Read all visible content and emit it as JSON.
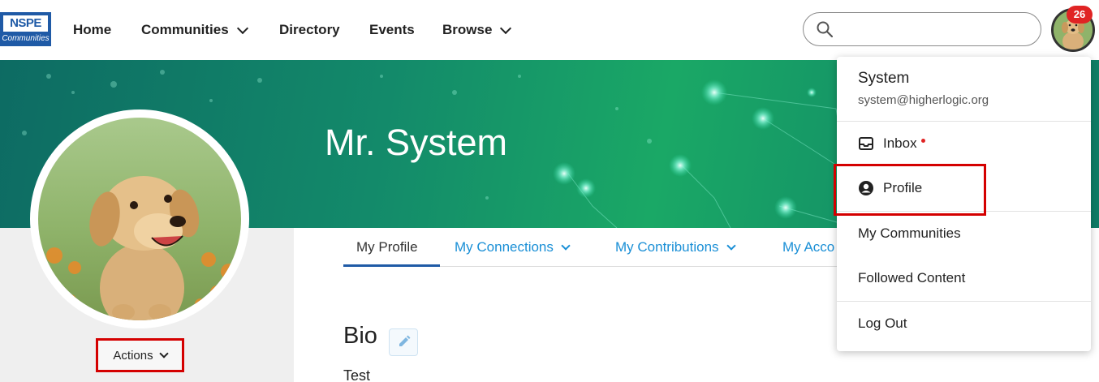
{
  "logo": {
    "top_text": "NSPE",
    "bottom_text": "Communities"
  },
  "nav": {
    "home": "Home",
    "communities": "Communities",
    "directory": "Directory",
    "events": "Events",
    "browse": "Browse"
  },
  "search": {
    "placeholder": ""
  },
  "notifications": {
    "count": "26"
  },
  "banner": {
    "name": "Mr. System"
  },
  "actions": {
    "label": "Actions"
  },
  "tabs": {
    "my_profile": "My Profile",
    "my_connections": "My Connections",
    "my_contributions": "My Contributions",
    "my_account": "My Acco"
  },
  "bio": {
    "heading": "Bio",
    "text": "Test"
  },
  "dropdown": {
    "name": "System",
    "email": "system@higherlogic.org",
    "inbox": "Inbox",
    "profile": "Profile",
    "my_communities": "My Communities",
    "followed_content": "Followed Content",
    "log_out": "Log Out"
  },
  "colors": {
    "accent_blue": "#1a8fd6",
    "brand_blue": "#1f5aa6",
    "alert_red": "#e02424",
    "highlight_red": "#d40000"
  }
}
